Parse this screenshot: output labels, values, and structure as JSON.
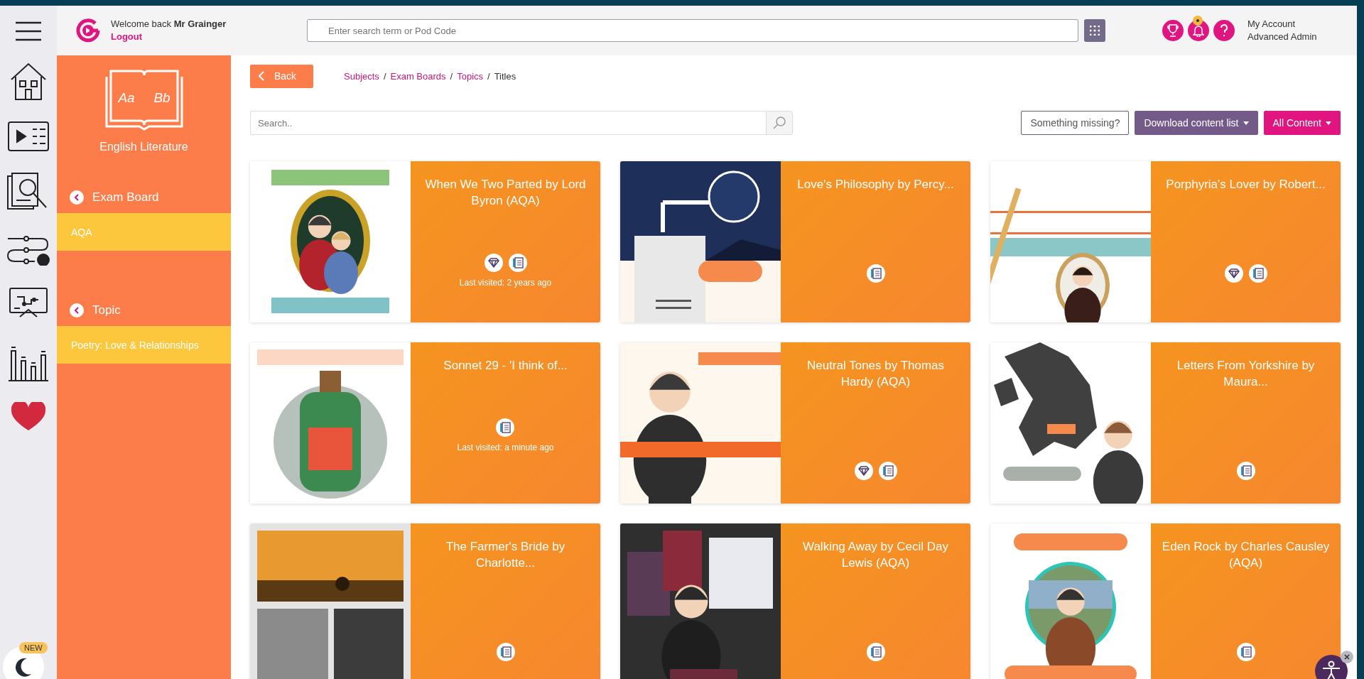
{
  "header": {
    "welcome": "Welcome back",
    "user": "Mr Grainger",
    "logout": "Logout",
    "search": {
      "placeholder": "Enter search term or Pod Code"
    },
    "account": "My Account",
    "role": "Advanced Admin",
    "notification_dot": true
  },
  "sidebar": {
    "new_badge": "NEW"
  },
  "subject": {
    "title": "English Literature",
    "book_letters": [
      "Aa",
      "Bb"
    ],
    "filters": [
      {
        "heading": "Exam Board",
        "value": "AQA"
      },
      {
        "heading": "Topic",
        "value": "Poetry: Love & Relationships"
      }
    ]
  },
  "toolbar": {
    "back": "Back",
    "breadcrumb": [
      {
        "label": "Subjects",
        "kind": "link"
      },
      {
        "label": "/",
        "kind": "separator"
      },
      {
        "label": "Exam Boards",
        "kind": "link"
      },
      {
        "label": "/",
        "kind": "separator"
      },
      {
        "label": "Topics",
        "kind": "link"
      },
      {
        "label": "/",
        "kind": "separator"
      },
      {
        "label": "Titles",
        "kind": "current"
      }
    ],
    "search": {
      "placeholder": "Search.."
    },
    "buttons": [
      {
        "label": "Something missing?",
        "kind": "outline"
      },
      {
        "label": "Download content list",
        "kind": "purple",
        "dropdown": true
      },
      {
        "label": "All Content",
        "kind": "pink",
        "dropdown": true
      }
    ]
  },
  "cards": [
    {
      "title": "When We Two Parted by Lord Byron (AQA)",
      "diamond": true,
      "last_visited": "Last visited: 2 years ago"
    },
    {
      "title": "Love's Philosophy by Percy...",
      "diamond": false
    },
    {
      "title": "Porphyria's Lover by Robert...",
      "diamond": true
    },
    {
      "title": "Sonnet 29 - 'I think of...",
      "diamond": false,
      "last_visited": "Last visited: a minute ago"
    },
    {
      "title": "Neutral Tones by Thomas Hardy (AQA)",
      "diamond": true
    },
    {
      "title": "Letters From Yorkshire by Maura...",
      "diamond": false
    },
    {
      "title": "The Farmer's Bride by Charlotte...",
      "diamond": false
    },
    {
      "title": "Walking Away by Cecil Day Lewis (AQA)",
      "diamond": false
    },
    {
      "title": "Eden Rock by Charles Causley (AQA)",
      "diamond": false
    }
  ]
}
